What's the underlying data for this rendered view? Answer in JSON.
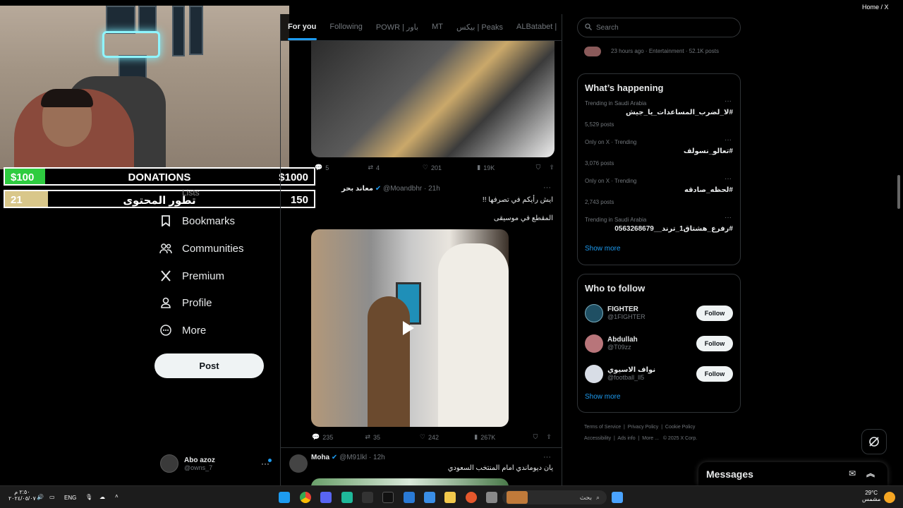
{
  "top_right": "Home / X",
  "overlay": {
    "donations": {
      "left": "$100",
      "center": "DONATIONS",
      "right": "$1000",
      "fill_color": "#2ecc40",
      "progress": 0.13
    },
    "content_goal": {
      "left": "21",
      "center": "تطور المحتوى",
      "right": "150",
      "fill_color": "#d9c78a",
      "progress": 0.14
    }
  },
  "nav": {
    "partial_item": "Lists",
    "items": [
      {
        "label": "Bookmarks",
        "icon": "bookmark-icon"
      },
      {
        "label": "Communities",
        "icon": "communities-icon"
      },
      {
        "label": "Premium",
        "icon": "x-logo-icon"
      },
      {
        "label": "Profile",
        "icon": "profile-icon"
      },
      {
        "label": "More",
        "icon": "more-icon"
      }
    ],
    "post_button": "Post",
    "account": {
      "name": "Abo azoz",
      "handle": "@owns_7"
    }
  },
  "tabs": [
    "For you",
    "Following",
    "POWR | باور",
    "MT",
    "بيكس | Peaks",
    "ALBatabet |"
  ],
  "tweet1": {
    "replies": "5",
    "retweets": "4",
    "likes": "201",
    "views": "19K"
  },
  "tweet2": {
    "name": "معاند بحر",
    "handle": "@Moandbhr",
    "time": "21h",
    "text1": "ايش رأيكم في تصرفها !!",
    "text2": "المقطع في موسيقى",
    "replies": "235",
    "retweets": "35",
    "likes": "242",
    "views": "267K"
  },
  "tweet3": {
    "name": "Moha",
    "handle": "@M91lkl",
    "time": "12h",
    "text": "يان ديوماندي امام المنتخب السعودي"
  },
  "search": {
    "placeholder": "Search"
  },
  "top_trend_meta": "23 hours ago · Entertainment · 52.1K posts",
  "happening": {
    "title": "What’s happening",
    "trends": [
      {
        "meta": "Trending in Saudi Arabia",
        "tag": "#لا_لضرب_المساعدات_يا_جيش",
        "count": "5,529 posts"
      },
      {
        "meta": "Only on X · Trending",
        "tag": "#تعالو_نسولف",
        "count": "3,076 posts"
      },
      {
        "meta": "Only on X · Trending",
        "tag": "#لحظه_صادقه",
        "count": "2,743 posts"
      },
      {
        "meta": "Trending in Saudi Arabia",
        "tag": "#رفرع_هشتاق1_ترند__0563268679",
        "count": ""
      }
    ],
    "show_more": "Show more"
  },
  "who_to_follow": {
    "title": "Who to follow",
    "people": [
      {
        "name": "FIGHTER",
        "handle": "@1FIGHTER",
        "button": "Follow",
        "avatar_color": "#1f4f63"
      },
      {
        "name": "Abdullah",
        "handle": "@T09zz",
        "button": "Follow",
        "avatar_color": "#b8757a"
      },
      {
        "name": "نواف الاسيوي",
        "handle": "@football_ll5",
        "button": "Follow",
        "avatar_color": "#d8dde6"
      }
    ],
    "show_more": "Show more"
  },
  "footer": {
    "line1": [
      "Terms of Service",
      "Privacy Policy",
      "Cookie Policy"
    ],
    "line2": [
      "Accessibility",
      "Ads info",
      "More ...",
      "© 2025 X Corp."
    ]
  },
  "messages": {
    "title": "Messages"
  },
  "taskbar": {
    "time": "٢:٥٠ م",
    "date": "٢٠٢٤/٠٥/٠٧",
    "lang": "ENG",
    "search_text": "بحث",
    "weather_temp": "29°C",
    "weather_desc": "مشمس"
  }
}
